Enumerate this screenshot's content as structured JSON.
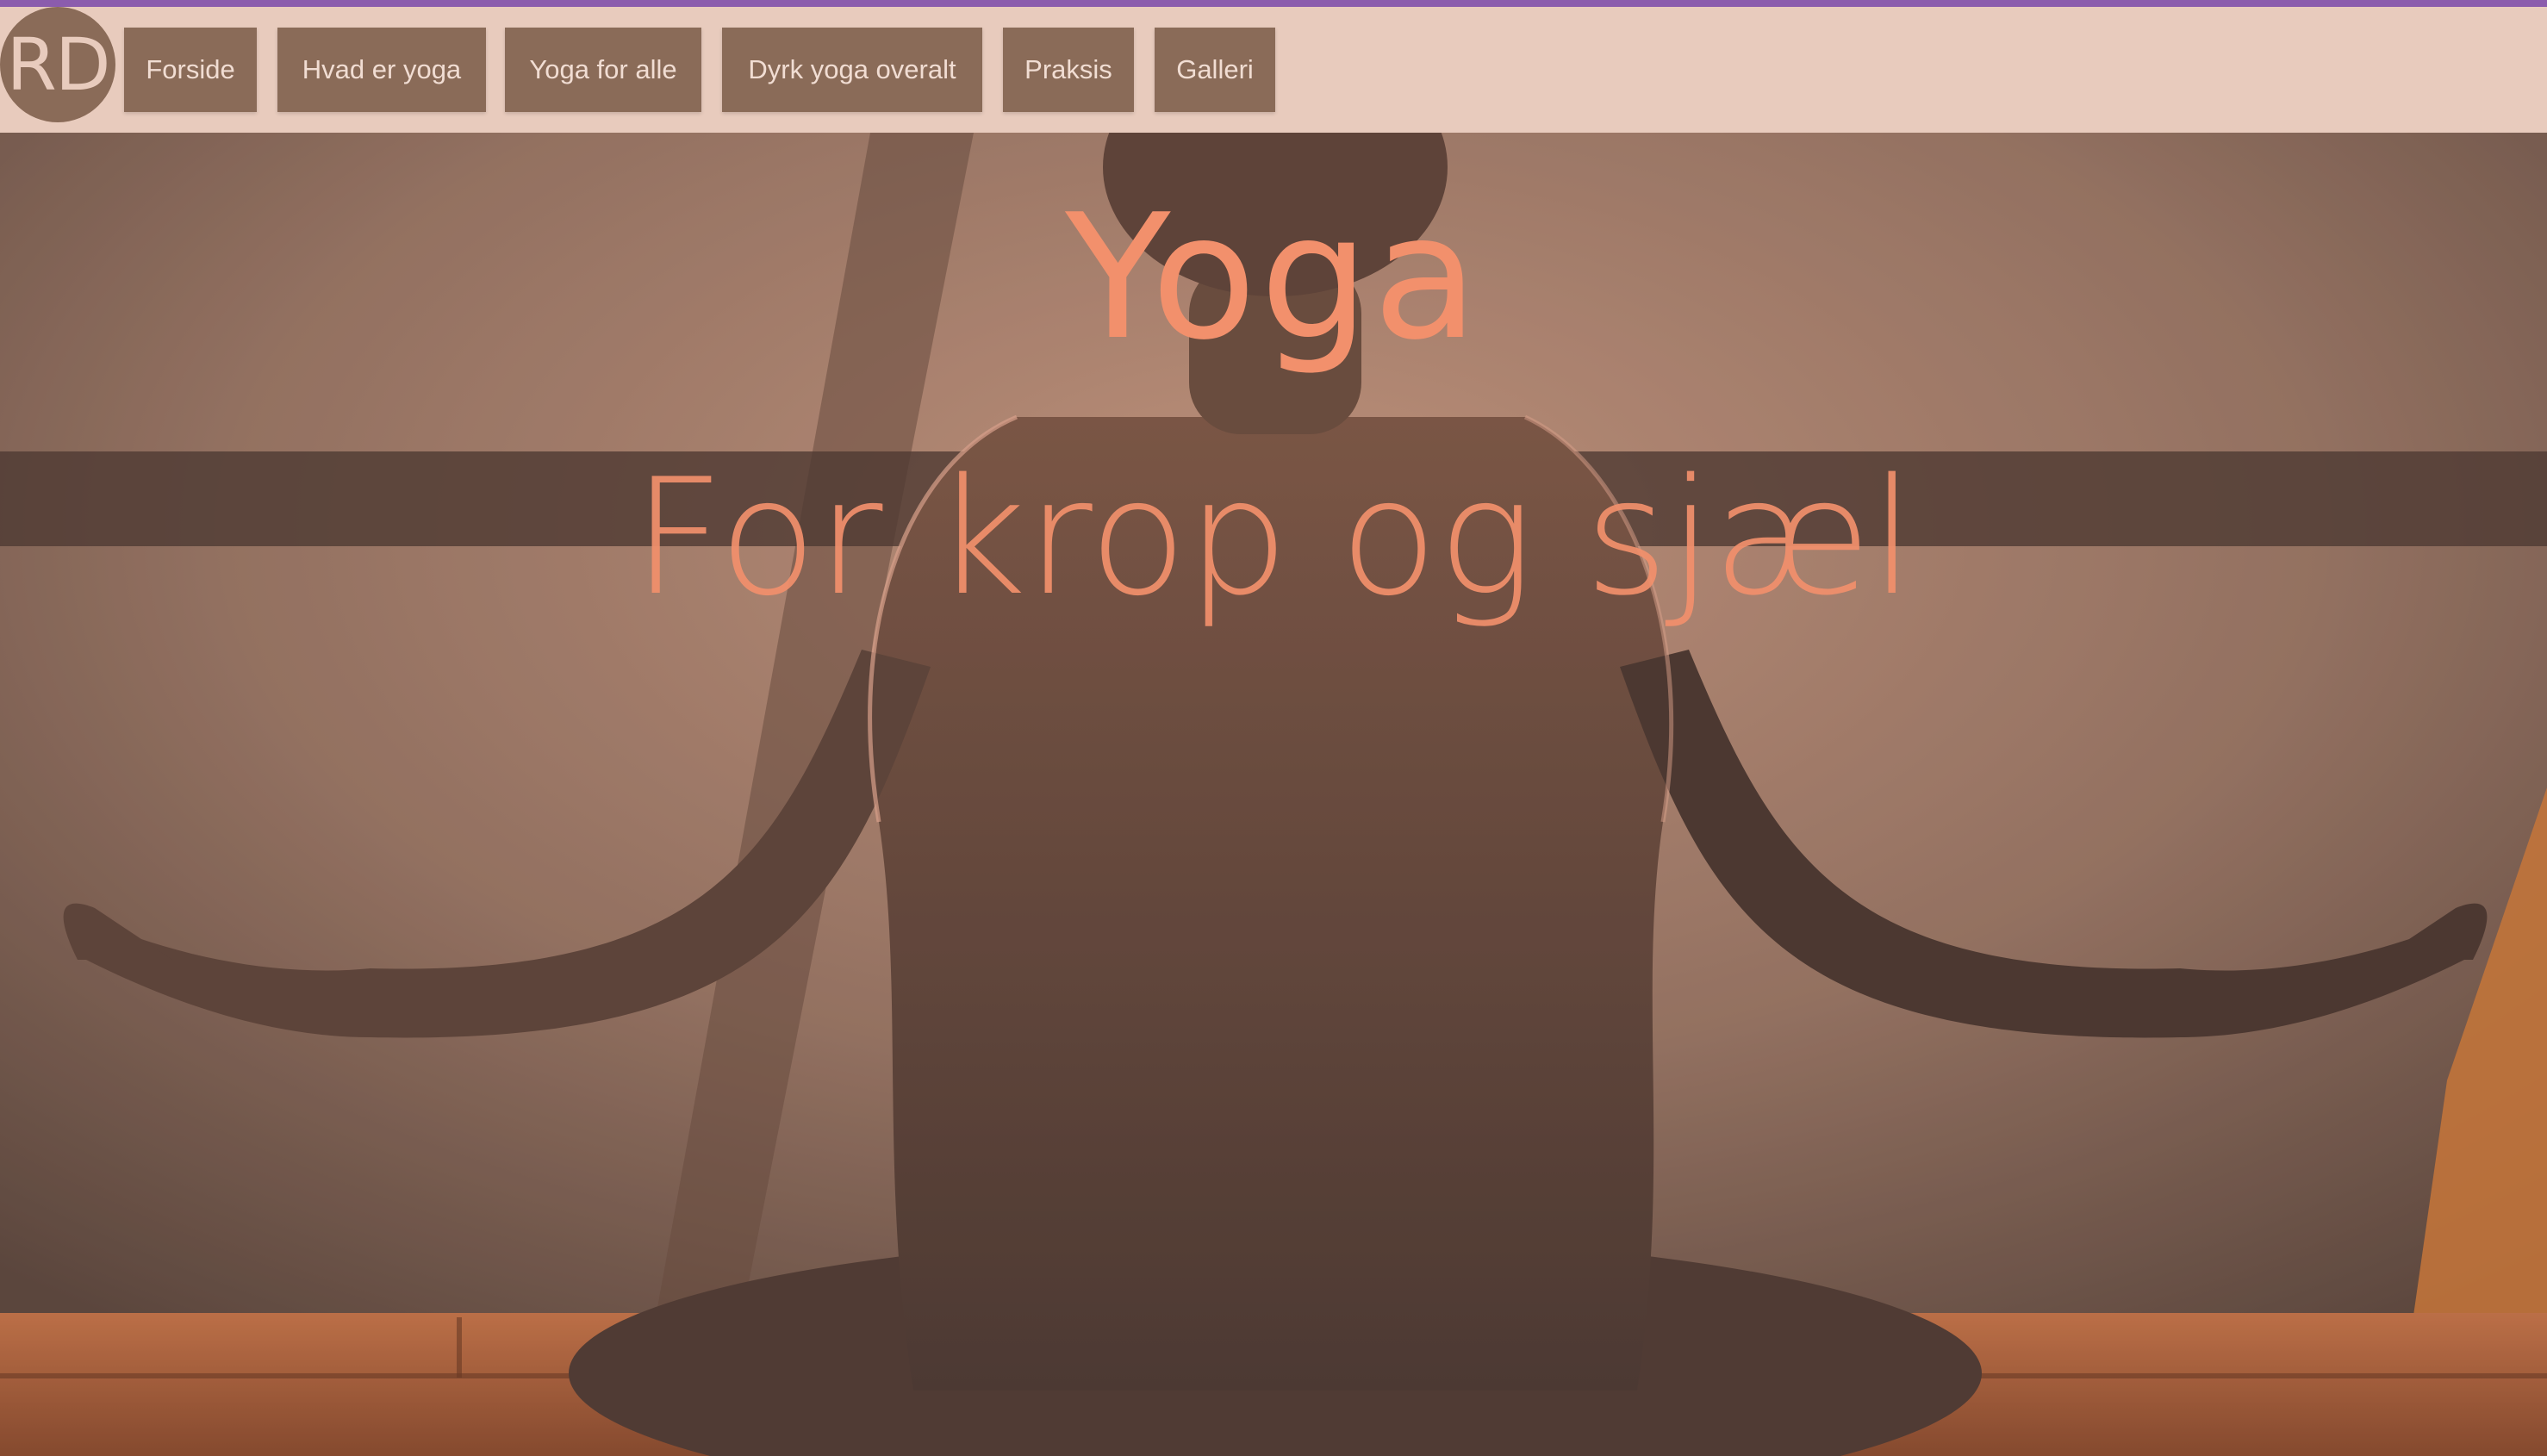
{
  "nav": {
    "logo_text": "RD",
    "items": [
      {
        "label": "Forside"
      },
      {
        "label": "Hvad er yoga"
      },
      {
        "label": "Yoga for alle"
      },
      {
        "label": "Dyrk yoga overalt"
      },
      {
        "label": "Praksis"
      },
      {
        "label": "Galleri"
      }
    ]
  },
  "hero": {
    "title": "Yoga",
    "subtitle": "For krop og sjæl"
  },
  "colors": {
    "accent_bar": "#8b5cad",
    "navbar_bg": "#e8cbbd",
    "nav_button_bg": "#8a6b58",
    "nav_button_text": "#f1ddd3",
    "hero_text": "#f2906c"
  }
}
